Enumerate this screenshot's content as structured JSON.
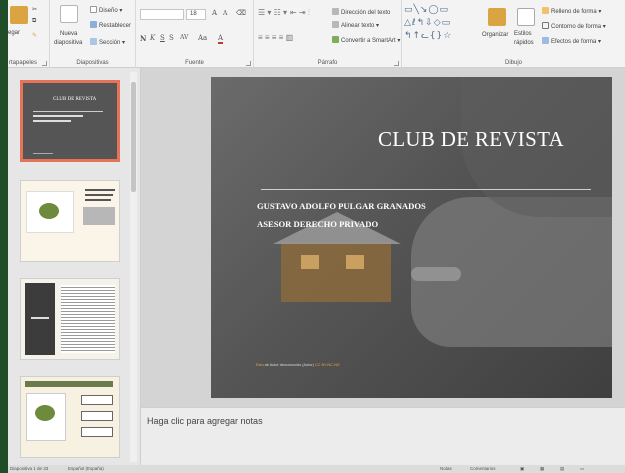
{
  "ribbon": {
    "portapapeles": {
      "paste_label": "egar",
      "group_label": "rtapapeles"
    },
    "diapositivas": {
      "new_label": "Nueva",
      "new_label2": "diapositiva",
      "layout_label": "Diseño",
      "reset_label": "Restablecer",
      "section_label": "Sección",
      "group_label": "Diapositivas"
    },
    "fuente": {
      "font_name": "",
      "font_size": "18",
      "grow": "A",
      "shrink": "A",
      "bold": "N",
      "italic": "K",
      "underline": "S",
      "strike": "S",
      "spacing": "AV",
      "case": "Aa",
      "color": "A",
      "group_label": "Fuente"
    },
    "parrafo": {
      "text_direction": "Dirección del texto",
      "align_text": "Alinear texto",
      "convert_smartart": "Convertir a SmartArt",
      "group_label": "Párrafo"
    },
    "dibujo": {
      "organize_label": "Organizar",
      "quick_styles_1": "Estilos",
      "quick_styles_2": "rápidos",
      "fill": "Relleno de forma",
      "outline": "Contorno de forma",
      "effects": "Efectos de forma",
      "group_label": "Dibujo"
    }
  },
  "thumbnails": [
    {
      "index": 1,
      "title": "CLUB DE REVISTA",
      "selected": true
    },
    {
      "index": 2,
      "title": "",
      "selected": false
    },
    {
      "index": 3,
      "title": "",
      "selected": false
    },
    {
      "index": 4,
      "title": "",
      "selected": false
    }
  ],
  "slide": {
    "title": "CLUB DE REVISTA",
    "line1": "GUSTAVO ADOLFO PULGAR GRANADOS",
    "line2": "ASESOR DERECHO PRIVADO",
    "footnote_prefix": "Esta",
    "footnote_middle": " de Autor desconocido (Autor) ",
    "footnote_suffix": "CC BY-NC-ND"
  },
  "notes": {
    "placeholder": "Haga clic para agregar notas"
  },
  "status": {
    "slide_counter": "Diapositiva 1 de 33",
    "language": "Español (España)",
    "notes_btn": "Notas",
    "comments_btn": "Comentarios"
  },
  "colors": {
    "selected_border": "#e5735a",
    "slide_bg": "#555555",
    "window_frame": "#1f4d2a"
  }
}
